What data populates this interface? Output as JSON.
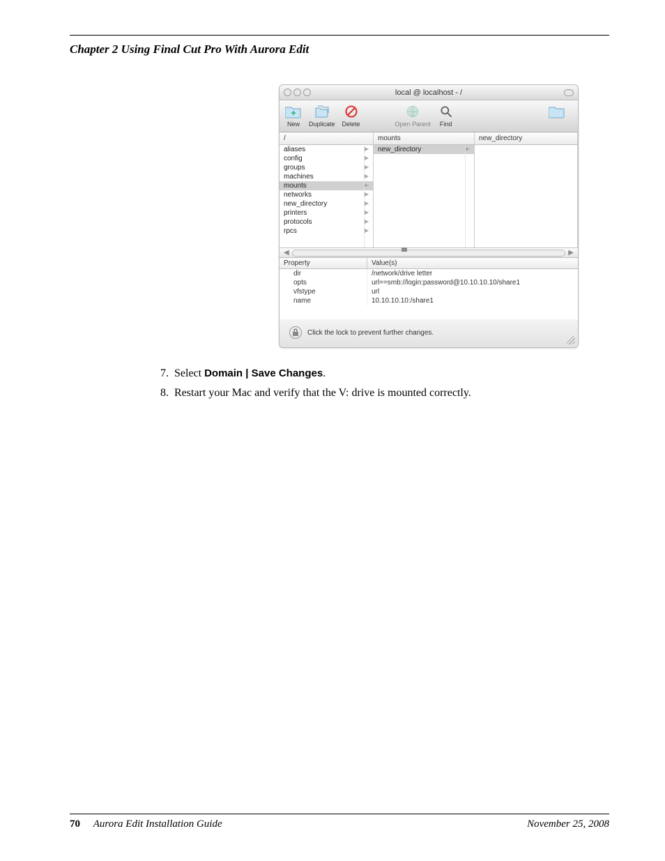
{
  "chapter": "Chapter 2   Using Final Cut Pro With Aurora Edit",
  "window": {
    "title": "local @ localhost - /",
    "toolbar": {
      "new": "New",
      "duplicate": "Duplicate",
      "delete": "Delete",
      "open_parent": "Open Parent",
      "find": "Find"
    },
    "columns": {
      "c1": "/",
      "c2": "mounts",
      "c3": "new_directory"
    },
    "list1": [
      "aliases",
      "config",
      "groups",
      "machines",
      "mounts",
      "networks",
      "new_directory",
      "printers",
      "protocols",
      "rpcs"
    ],
    "list1_selected": "mounts",
    "list2": [
      "new_directory"
    ],
    "list2_selected": "new_directory",
    "prop_header": {
      "p": "Property",
      "v": "Value(s)"
    },
    "props": [
      {
        "k": "dir",
        "v": "/network/drive letter"
      },
      {
        "k": "opts",
        "v": "url==smb://login:password@10.10.10.10/share1"
      },
      {
        "k": "vfstype",
        "v": "url"
      },
      {
        "k": "name",
        "v": "10.10.10.10:/share1"
      }
    ],
    "lock_text": "Click the lock to prevent further changes."
  },
  "steps": {
    "s7a": "Select ",
    "s7b": "Domain | Save Changes",
    "s7c": ".",
    "s8": "Restart your Mac and verify that the V: drive is mounted correctly."
  },
  "footer": {
    "page": "70",
    "guide": "Aurora Edit Installation Guide",
    "date": "November 25, 2008"
  }
}
